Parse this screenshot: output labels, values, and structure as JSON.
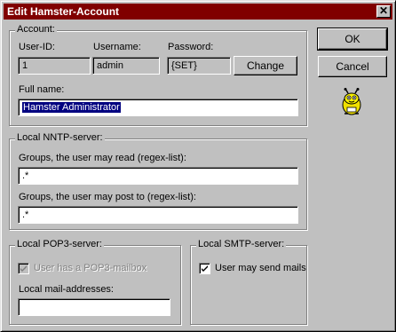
{
  "window": {
    "title": "Edit Hamster-Account",
    "close_glyph": "✕"
  },
  "account": {
    "legend": "Account:",
    "userid_label": "User-ID:",
    "userid_value": "1",
    "username_label": "Username:",
    "username_value": "admin",
    "password_label": "Password:",
    "password_value": "{SET}",
    "change_label": "Change",
    "fullname_label": "Full name:",
    "fullname_value": "Hamster Administrator"
  },
  "nntp": {
    "legend": "Local NNTP-server:",
    "read_label": "Groups, the user may read (regex-list):",
    "read_value": ".*",
    "post_label": "Groups, the user may post to (regex-list):",
    "post_value": ".*"
  },
  "pop3": {
    "legend": "Local POP3-server:",
    "mailbox_label": "User has a POP3-mailbox",
    "mailbox_checked": true,
    "mailbox_enabled": false,
    "addresses_label": "Local mail-addresses:",
    "addresses_value": ""
  },
  "smtp": {
    "legend": "Local SMTP-server:",
    "send_label": "User may send mails",
    "send_checked": true
  },
  "buttons": {
    "ok": "OK",
    "cancel": "Cancel"
  },
  "icons": {
    "mascot": "hamster-mascot-icon"
  }
}
